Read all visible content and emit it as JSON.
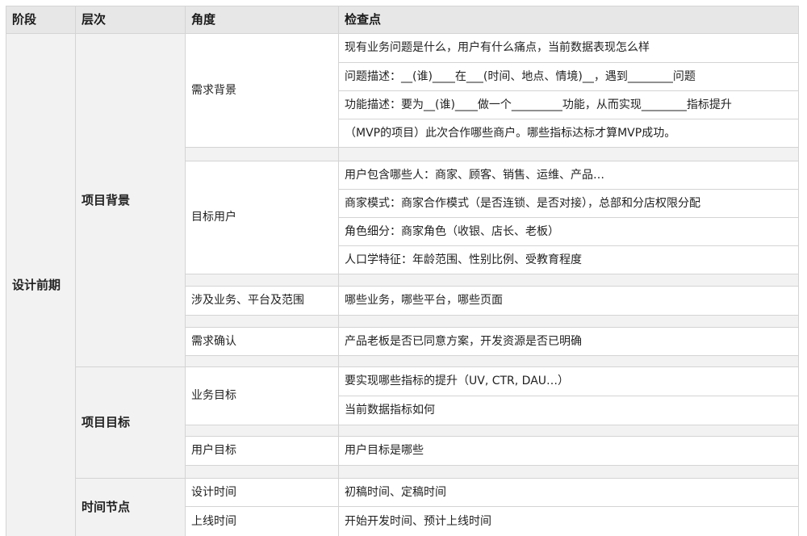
{
  "headers": [
    "阶段",
    "层次",
    "角度",
    "检查点"
  ],
  "stage": "设计前期",
  "levels": [
    {
      "name": "项目背景",
      "angles": [
        {
          "name": "需求背景",
          "checks": [
            "现有业务问题是什么，用户有什么痛点，当前数据表现怎么样",
            "问题描述：__(谁)____在___(时间、地点、情境)__，遇到________问题",
            "功能描述：要为__(谁)____做一个_________功能，从而实现________指标提升",
            "（MVP的项目）此次合作哪些商户。哪些指标达标才算MVP成功。"
          ]
        },
        {
          "name": "目标用户",
          "checks": [
            "用户包含哪些人：商家、顾客、销售、运维、产品…",
            "商家模式：商家合作模式（是否连锁、是否对接），总部和分店权限分配",
            "角色细分：商家角色（收银、店长、老板）",
            "人口学特征：年龄范围、性别比例、受教育程度"
          ]
        },
        {
          "name": "涉及业务、平台及范围",
          "checks": [
            "哪些业务，哪些平台，哪些页面"
          ]
        },
        {
          "name": "需求确认",
          "checks": [
            "产品老板是否已同意方案，开发资源是否已明确"
          ]
        }
      ]
    },
    {
      "name": "项目目标",
      "angles": [
        {
          "name": "业务目标",
          "checks": [
            "要实现哪些指标的提升（UV, CTR, DAU…）",
            "当前数据指标如何"
          ]
        },
        {
          "name": "用户目标",
          "checks": [
            "用户目标是哪些"
          ]
        }
      ]
    },
    {
      "name": "时间节点",
      "angles": [
        {
          "name": "设计时间",
          "checks": [
            "初稿时间、定稿时间"
          ]
        },
        {
          "name": "上线时间",
          "checks": [
            "开始开发时间、预计上线时间"
          ]
        }
      ]
    }
  ]
}
